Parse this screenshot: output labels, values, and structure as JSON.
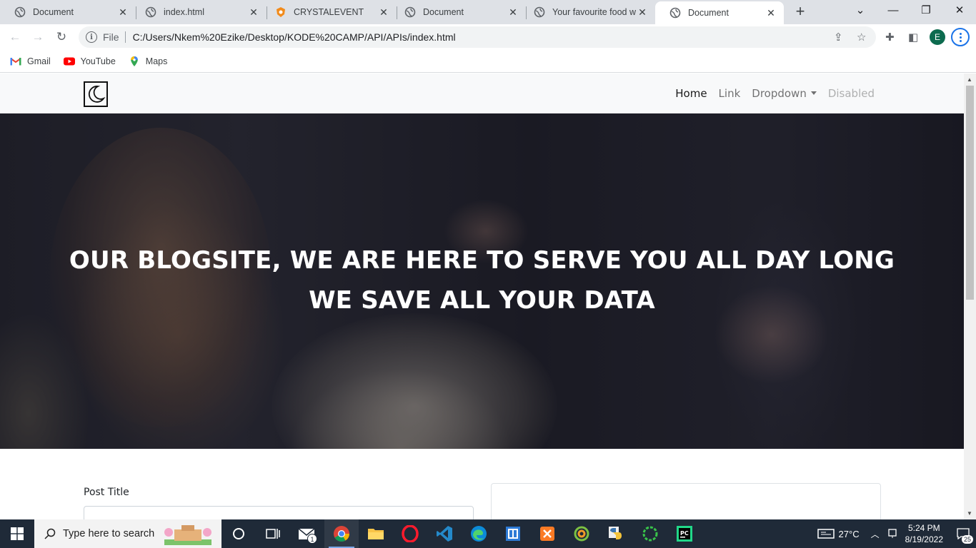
{
  "browser": {
    "tabs": [
      {
        "title": "Document",
        "icon": "globe-icon"
      },
      {
        "title": "index.html",
        "icon": "globe-icon"
      },
      {
        "title": "CRYSTALEVENT",
        "icon": "orange-shield-icon"
      },
      {
        "title": "Document",
        "icon": "globe-icon"
      },
      {
        "title": "Your favourite food w",
        "icon": "globe-icon"
      },
      {
        "title": "Document",
        "icon": "globe-icon",
        "active": true
      }
    ],
    "address": {
      "scheme_label": "File",
      "url": "C:/Users/Nkem%20Ezike/Desktop/KODE%20CAMP/API/APIs/index.html"
    },
    "profile_initial": "E",
    "bookmarks": [
      {
        "label": "Gmail",
        "icon": "gmail-icon"
      },
      {
        "label": "YouTube",
        "icon": "youtube-icon"
      },
      {
        "label": "Maps",
        "icon": "maps-icon"
      }
    ]
  },
  "page": {
    "nav": {
      "logo_icon": "crescent-moon-icon",
      "links": [
        {
          "label": "Home",
          "state": "active"
        },
        {
          "label": "Link",
          "state": "normal"
        },
        {
          "label": "Dropdown",
          "state": "dropdown"
        },
        {
          "label": "Disabled",
          "state": "disabled"
        }
      ]
    },
    "hero": {
      "line1": "OUR BLOGSITE, WE ARE HERE TO SERVE YOU ALL DAY LONG",
      "line2": "WE SAVE ALL YOUR DATA"
    },
    "form": {
      "post_title_label": "Post Title"
    }
  },
  "taskbar": {
    "search_placeholder": "Type here to search",
    "weather": "27°C",
    "time": "5:24 PM",
    "date": "8/19/2022",
    "notification_count": "25",
    "mail_badge": "1",
    "colors": {
      "bar": "#1f2a38",
      "accent": "#7aa7e8"
    }
  }
}
